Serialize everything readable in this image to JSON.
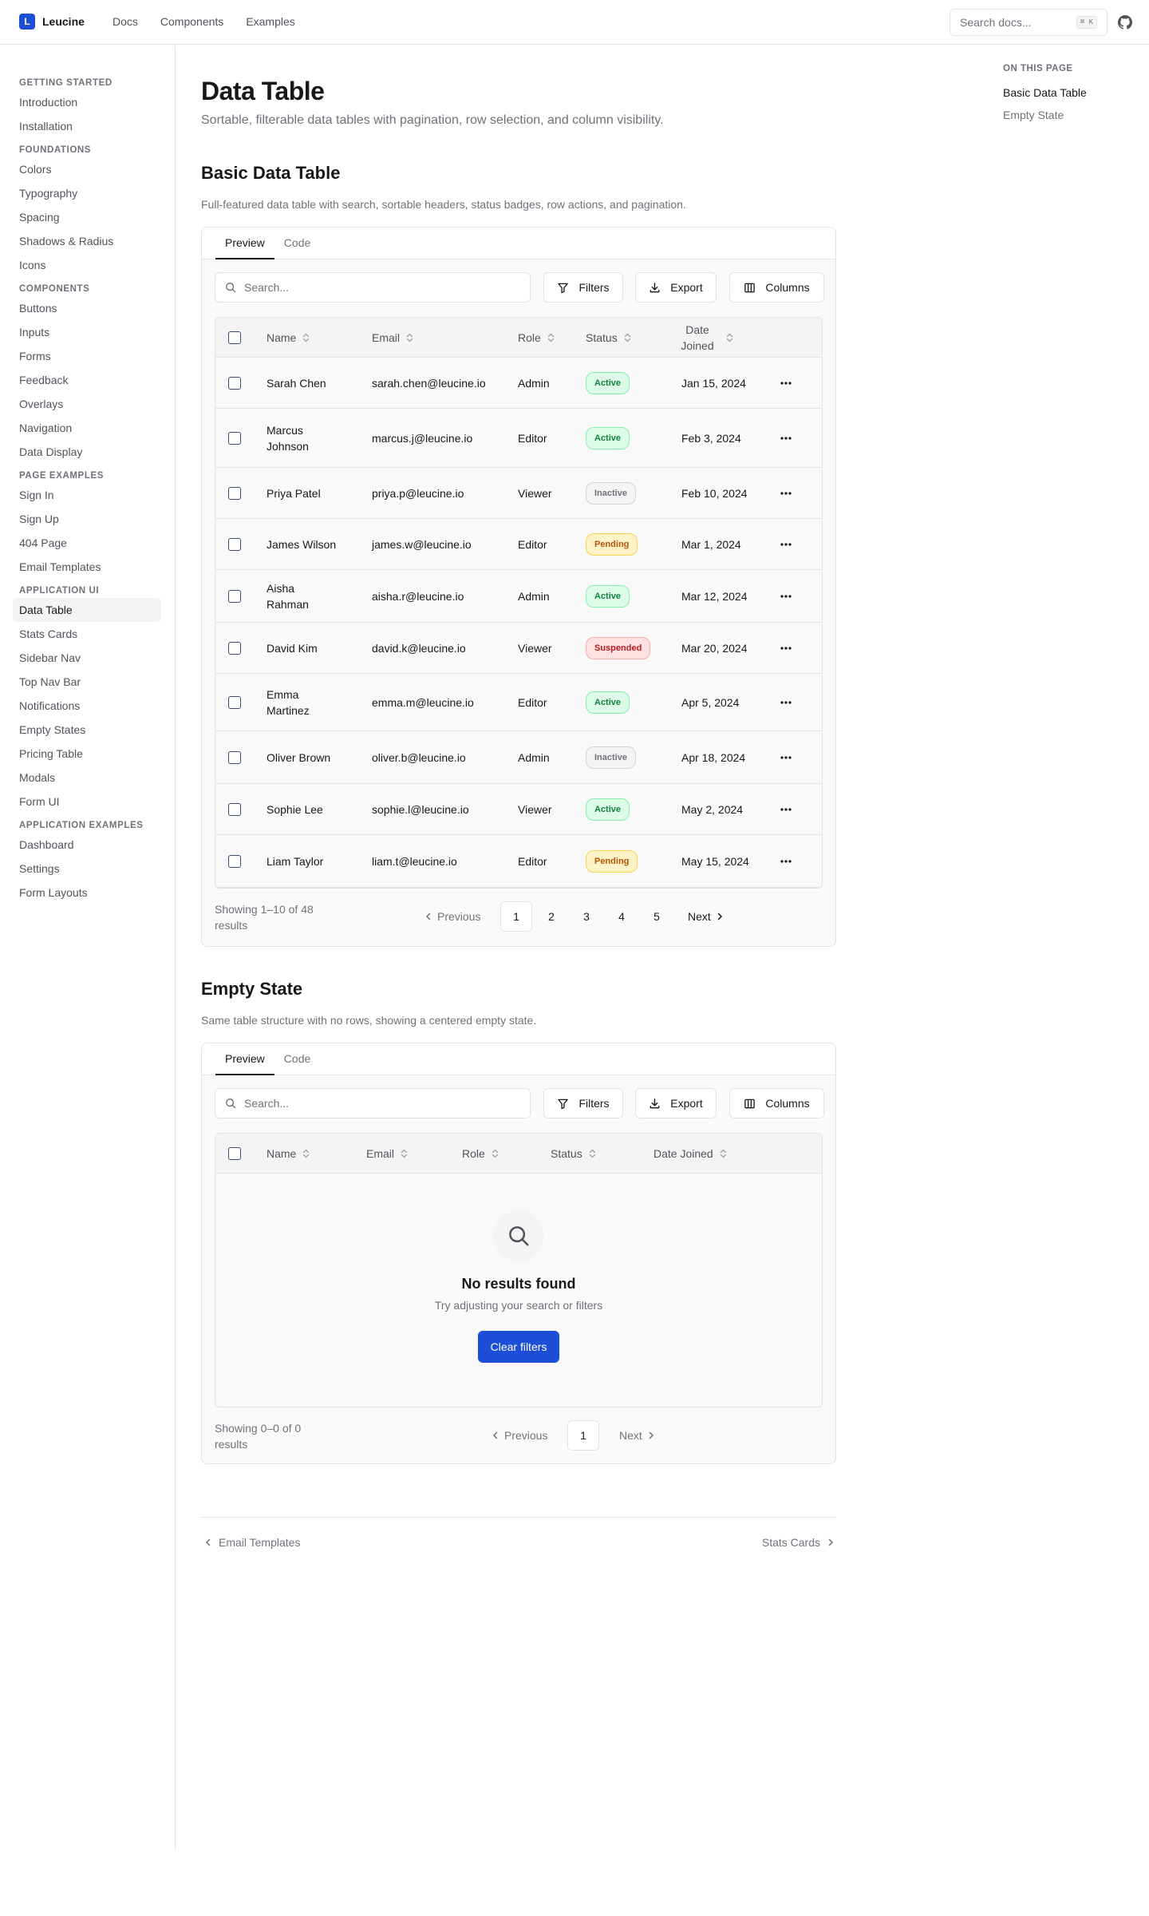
{
  "brand": {
    "logo": "L",
    "name": "Leucine"
  },
  "topnav": [
    "Docs",
    "Components",
    "Examples"
  ],
  "search_docs": {
    "placeholder": "Search docs...",
    "shortcut": "⌘ K"
  },
  "sidebar": [
    {
      "section": "GETTING STARTED",
      "items": [
        "Introduction",
        "Installation"
      ]
    },
    {
      "section": "FOUNDATIONS",
      "items": [
        "Colors",
        "Typography",
        "Spacing",
        "Shadows & Radius",
        "Icons"
      ]
    },
    {
      "section": "COMPONENTS",
      "items": [
        "Buttons",
        "Inputs",
        "Forms",
        "Feedback",
        "Overlays",
        "Navigation",
        "Data Display"
      ]
    },
    {
      "section": "PAGE EXAMPLES",
      "items": [
        "Sign In",
        "Sign Up",
        "404 Page",
        "Email Templates"
      ]
    },
    {
      "section": "APPLICATION UI",
      "items": [
        "Data Table",
        "Stats Cards",
        "Sidebar Nav",
        "Top Nav Bar",
        "Notifications",
        "Empty States",
        "Pricing Table",
        "Modals",
        "Form UI"
      ]
    },
    {
      "section": "APPLICATION EXAMPLES",
      "items": [
        "Dashboard",
        "Settings",
        "Form Layouts"
      ]
    }
  ],
  "sidebar_active": "Data Table",
  "toc": {
    "title": "ON THIS PAGE",
    "items": [
      "Basic Data Table",
      "Empty State"
    ],
    "active": "Basic Data Table"
  },
  "page": {
    "title": "Data Table",
    "subtitle": "Sortable, filterable data tables with pagination, row selection, and column visibility."
  },
  "common": {
    "tab_preview": "Preview",
    "tab_code": "Code",
    "search_placeholder": "Search...",
    "filters": "Filters",
    "export": "Export",
    "columns": "Columns",
    "previous": "Previous",
    "next": "Next"
  },
  "basic": {
    "heading": "Basic Data Table",
    "description": "Full-featured data table with search, sortable headers, status badges, row actions, and pagination.",
    "headers": [
      "Name",
      "Email",
      "Role",
      "Status",
      "Date Joined"
    ],
    "rows": [
      {
        "name": "Sarah Chen",
        "email": "sarah.chen@leucine.io",
        "role": "Admin",
        "status": "Active",
        "date": "Jan 15, 2024"
      },
      {
        "name": "Marcus Johnson",
        "email": "marcus.j@leucine.io",
        "role": "Editor",
        "status": "Active",
        "date": "Feb 3, 2024"
      },
      {
        "name": "Priya Patel",
        "email": "priya.p@leucine.io",
        "role": "Viewer",
        "status": "Inactive",
        "date": "Feb 10, 2024"
      },
      {
        "name": "James Wilson",
        "email": "james.w@leucine.io",
        "role": "Editor",
        "status": "Pending",
        "date": "Mar 1, 2024"
      },
      {
        "name": "Aisha Rahman",
        "email": "aisha.r@leucine.io",
        "role": "Admin",
        "status": "Active",
        "date": "Mar 12, 2024"
      },
      {
        "name": "David Kim",
        "email": "david.k@leucine.io",
        "role": "Viewer",
        "status": "Suspended",
        "date": "Mar 20, 2024"
      },
      {
        "name": "Emma Martinez",
        "email": "emma.m@leucine.io",
        "role": "Editor",
        "status": "Active",
        "date": "Apr 5, 2024"
      },
      {
        "name": "Oliver Brown",
        "email": "oliver.b@leucine.io",
        "role": "Admin",
        "status": "Inactive",
        "date": "Apr 18, 2024"
      },
      {
        "name": "Sophie Lee",
        "email": "sophie.l@leucine.io",
        "role": "Viewer",
        "status": "Active",
        "date": "May 2, 2024"
      },
      {
        "name": "Liam Taylor",
        "email": "liam.t@leucine.io",
        "role": "Editor",
        "status": "Pending",
        "date": "May 15, 2024"
      }
    ],
    "row_action_icon": "more-horizontal-icon",
    "showing": "Showing 1–10 of 48 results",
    "pages": [
      "1",
      "2",
      "3",
      "4",
      "5"
    ],
    "current_page": "1"
  },
  "empty": {
    "heading": "Empty State",
    "description": "Same table structure with no rows, showing a centered empty state.",
    "headers": [
      "Name",
      "Email",
      "Role",
      "Status",
      "Date Joined"
    ],
    "title": "No results found",
    "message": "Try adjusting your search or filters",
    "button": "Clear filters",
    "showing": "Showing 0–0 of 0 results",
    "pages": [
      "1"
    ],
    "current_page": "1"
  },
  "footer": {
    "prev": "Email Templates",
    "next": "Stats Cards"
  },
  "colors": {
    "accent": "#1d4ed8",
    "active_badge": "#15803d",
    "pending_badge": "#b45309",
    "suspended_badge": "#b91c1c"
  }
}
